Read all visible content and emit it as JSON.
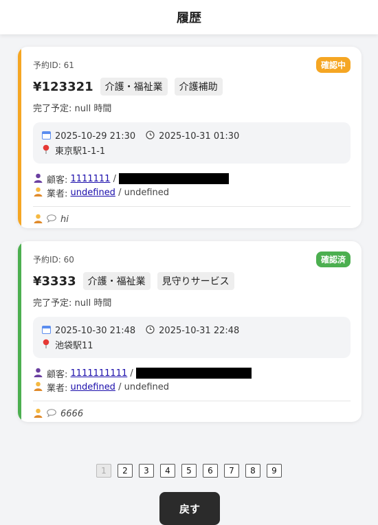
{
  "header": {
    "title": "履歴"
  },
  "reservations": [
    {
      "id_text": "予約ID: 61",
      "status": "確認中",
      "status_color": "#f5a623",
      "price": "¥123321",
      "tags": [
        "介護・福祉業",
        "介護補助"
      ],
      "completion": "完了予定: null 時間",
      "start": "2025-10-29 21:30",
      "end": "2025-10-31 01:30",
      "location": "東京駅1-1-1",
      "customer_label": "顧客:",
      "customer_id": "1111111",
      "provider_label": "業者:",
      "provider_id": "undefined",
      "provider_extra": "/ undefined",
      "note": "hi"
    },
    {
      "id_text": "予約ID: 60",
      "status": "確認済",
      "status_color": "#4caf50",
      "price": "¥3333",
      "tags": [
        "介護・福祉業",
        "見守りサービス"
      ],
      "completion": "完了予定: null 時間",
      "start": "2025-10-30 21:48",
      "end": "2025-10-31 22:48",
      "location": "池袋駅11",
      "customer_label": "顧客:",
      "customer_id": "1111111111",
      "provider_label": "業者:",
      "provider_id": "undefined",
      "provider_extra": "/ undefined",
      "note": "6666"
    }
  ],
  "icons": {
    "calendar": "calendar-icon",
    "clock": "clock-icon",
    "pin": "pin-icon",
    "customer": "person-icon",
    "provider": "worker-icon",
    "comment": "speech-bubble-icon"
  },
  "pagination": {
    "current": "1",
    "pages": [
      "1",
      "2",
      "3",
      "4",
      "5",
      "6",
      "7",
      "8",
      "9"
    ]
  },
  "back_button": "戻す"
}
